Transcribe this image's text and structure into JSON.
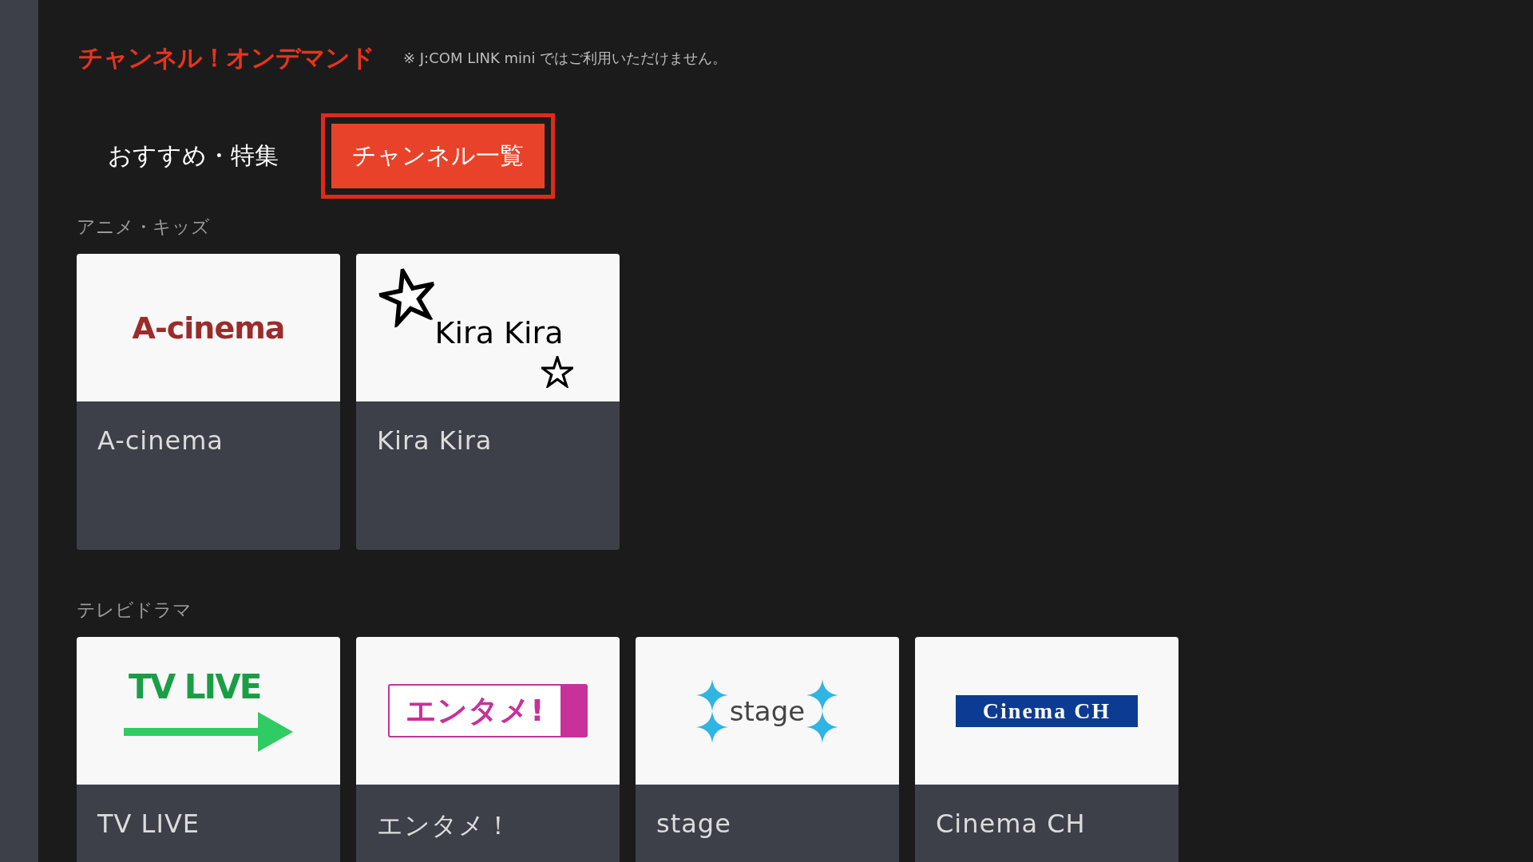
{
  "header": {
    "title": "チャンネル！オンデマンド",
    "note": "※ J:COM LINK mini ではご利用いただけません。"
  },
  "tabs": [
    {
      "label": "おすすめ・特集",
      "selected": false
    },
    {
      "label": "チャンネル一覧",
      "selected": true
    }
  ],
  "sections": [
    {
      "title": "アニメ・キッズ",
      "channels": [
        {
          "name": "A-cinema",
          "kind": "wordmark",
          "logo_text": "A-cinema"
        },
        {
          "name": "Kira Kira",
          "kind": "stars",
          "logo_text": "Kira Kira"
        }
      ]
    },
    {
      "title": "テレビドラマ",
      "channels": [
        {
          "name": "TV LIVE",
          "kind": "arrow",
          "logo_text": "TV LIVE"
        },
        {
          "name": "エンタメ！",
          "kind": "tag",
          "logo_text": "エンタメ!"
        },
        {
          "name": "stage",
          "kind": "sparkles",
          "logo_text": "stage"
        },
        {
          "name": "Cinema CH",
          "kind": "banner",
          "logo_text": "Cinema CH"
        }
      ]
    }
  ]
}
